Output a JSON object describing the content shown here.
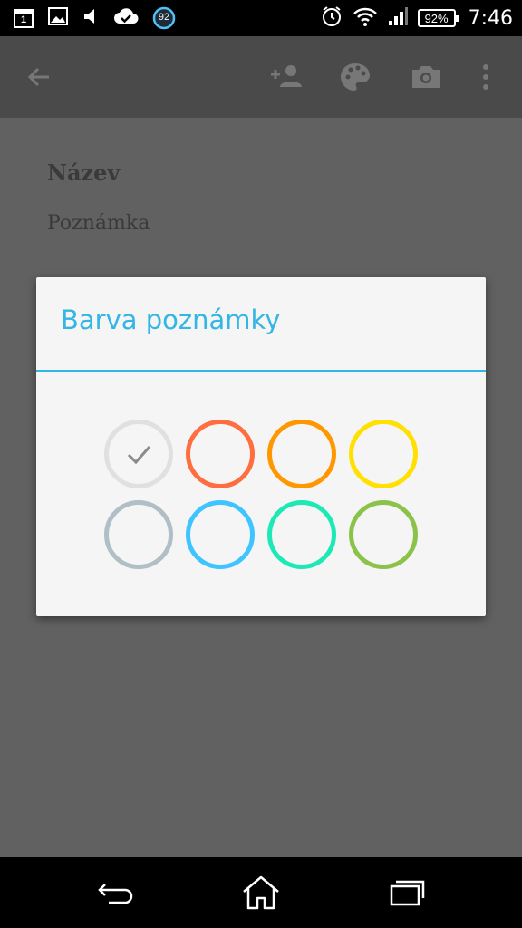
{
  "status_bar": {
    "time": "7:46",
    "battery": "92%",
    "calendar_date": "1",
    "sync_badge": "92",
    "icons": [
      "calendar-icon",
      "image-icon",
      "volume-icon",
      "cloud-check-icon",
      "sync-badge-icon",
      "alarm-icon",
      "wifi-icon",
      "signal-icon",
      "battery-icon"
    ]
  },
  "toolbar": {
    "icons": [
      "back-arrow-icon",
      "add-person-icon",
      "palette-icon",
      "camera-icon",
      "overflow-menu-icon"
    ]
  },
  "note": {
    "title": "Název",
    "body": "Poznámka"
  },
  "dialog": {
    "title": "Barva poznámky",
    "colors": [
      {
        "name": "white",
        "hex": "#e0e0e0",
        "selected": true
      },
      {
        "name": "red",
        "hex": "#ff6e40"
      },
      {
        "name": "orange",
        "hex": "#ff9800"
      },
      {
        "name": "yellow",
        "hex": "#ffe000"
      },
      {
        "name": "gray",
        "hex": "#b0bec5"
      },
      {
        "name": "blue",
        "hex": "#40c4ff"
      },
      {
        "name": "teal",
        "hex": "#1de9b6"
      },
      {
        "name": "green",
        "hex": "#8bc34a"
      }
    ],
    "accent": "#33b5e5"
  },
  "nav_bar": {
    "icons": [
      "back-icon",
      "home-icon",
      "recents-icon"
    ]
  }
}
